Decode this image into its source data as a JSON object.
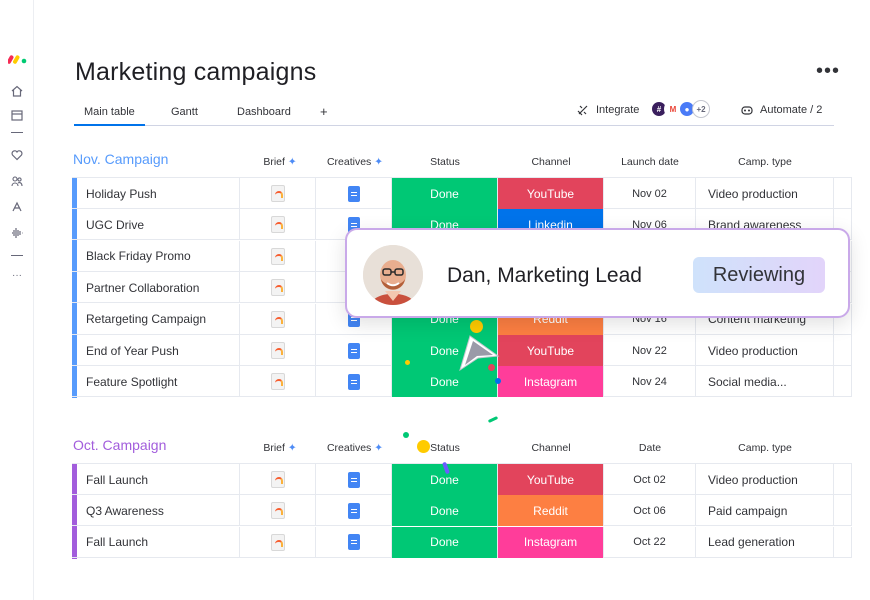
{
  "board": {
    "title": "Marketing campaigns",
    "more_label": "•••"
  },
  "tabs": [
    {
      "label": "Main table",
      "active": true
    },
    {
      "label": "Gantt",
      "active": false
    },
    {
      "label": "Dashboard",
      "active": false
    },
    {
      "label": "+",
      "active": false
    }
  ],
  "toolbar": {
    "integrate_label": "Integrate",
    "apps_more": "+2",
    "automate_label": "Automate / 2"
  },
  "colors": {
    "accent": "#0073ea",
    "done": "#00c875",
    "youtube": "#e2445c",
    "linkedin": "#0073ea",
    "reddit": "#fd7f42",
    "instagram": "#ff3d9a",
    "group_nov": "#579bfc",
    "group_oct": "#a25ddc"
  },
  "groups": [
    {
      "title": "Nov. Campaign",
      "color": "#579bfc",
      "columns": [
        "Brief",
        "Creatives",
        "Status",
        "Channel",
        "Launch date",
        "Camp. type"
      ],
      "rows": [
        {
          "name": "Holiday Push",
          "status": "Done",
          "channel": "YouTube",
          "channel_color": "#e2445c",
          "date": "Nov 02",
          "type": "Video production"
        },
        {
          "name": "UGC Drive",
          "status": "Done",
          "channel": "Linkedin",
          "channel_color": "#0073ea",
          "date": "Nov 06",
          "type": "Brand awareness"
        },
        {
          "name": "Black Friday Promo",
          "status": "",
          "channel": "",
          "channel_color": "#fd7f42",
          "date": "",
          "type": ""
        },
        {
          "name": "Partner Collaboration",
          "status": "",
          "channel": "",
          "channel_color": "#fd7f42",
          "date": "",
          "type": ""
        },
        {
          "name": "Retargeting Campaign",
          "status": "Done",
          "channel": "Reddit",
          "channel_color": "#fd7f42",
          "date": "Nov 16",
          "type": "Content marketing"
        },
        {
          "name": "End of Year Push",
          "status": "Done",
          "channel": "YouTube",
          "channel_color": "#e2445c",
          "date": "Nov 22",
          "type": "Video production"
        },
        {
          "name": "Feature Spotlight",
          "status": "Done",
          "channel": "Instagram",
          "channel_color": "#ff3d9a",
          "date": "Nov 24",
          "type": "Social media..."
        }
      ]
    },
    {
      "title": "Oct. Campaign",
      "color": "#a25ddc",
      "columns": [
        "Brief",
        "Creatives",
        "Status",
        "Channel",
        "Date",
        "Camp. type"
      ],
      "rows": [
        {
          "name": "Fall Launch",
          "status": "Done",
          "channel": "YouTube",
          "channel_color": "#e2445c",
          "date": "Oct 02",
          "type": "Video production"
        },
        {
          "name": "Q3 Awareness",
          "status": "Done",
          "channel": "Reddit",
          "channel_color": "#fd7f42",
          "date": "Oct 06",
          "type": "Paid campaign"
        },
        {
          "name": "Fall Launch",
          "status": "Done",
          "channel": "Instagram",
          "channel_color": "#ff3d9a",
          "date": "Oct 22",
          "type": "Lead generation"
        }
      ]
    }
  ],
  "popup": {
    "name": "Dan, Marketing Lead",
    "badge": "Reviewing"
  },
  "icons": [
    "monday-logo",
    "home-icon",
    "calendar-icon",
    "heart-icon",
    "team-icon",
    "apps-icon",
    "waveform-icon",
    "more-icon",
    "integrate-icon",
    "automate-icon",
    "sparkle-icon",
    "brief-file-icon",
    "doc-icon",
    "cursor-icon"
  ]
}
